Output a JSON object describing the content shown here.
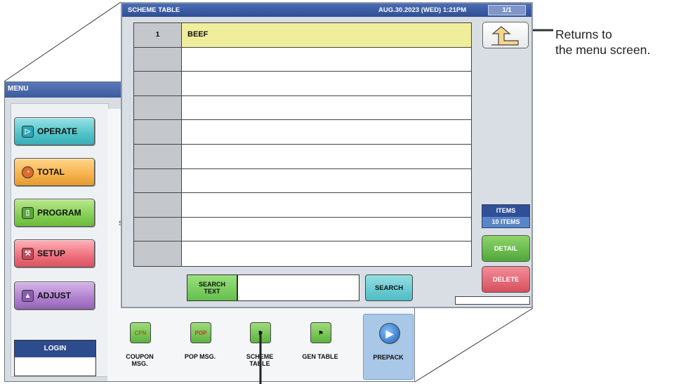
{
  "menu_window": {
    "title": "MENU",
    "stray_char": "S",
    "buttons": [
      {
        "label": "OPERATE",
        "icon": "play-circle-icon"
      },
      {
        "label": "TOTAL",
        "icon": "clock-icon"
      },
      {
        "label": "PROGRAM",
        "icon": "book-icon"
      },
      {
        "label": "SETUP",
        "icon": "wrench-icon"
      },
      {
        "label": "ADJUST",
        "icon": "adjust-icon"
      }
    ],
    "login_label": "LOGIN",
    "icon_row": [
      {
        "label": "COUPON\nMSG.",
        "icon_text": "CPN"
      },
      {
        "label": "POP MSG.",
        "icon_text": "POP"
      },
      {
        "label": "SCHEME\nTABLE",
        "icon_text": ""
      },
      {
        "label": "GEN TABLE",
        "icon_text": ""
      },
      {
        "label": "PREPACK",
        "icon_text": ""
      }
    ]
  },
  "scheme_window": {
    "title": "SCHEME TABLE",
    "datetime": "AUG.30.2023 (WED)  1:21PM",
    "page": "1/1",
    "rows": [
      {
        "num": "1",
        "name": "BEEF"
      },
      {
        "num": "",
        "name": ""
      },
      {
        "num": "",
        "name": ""
      },
      {
        "num": "",
        "name": ""
      },
      {
        "num": "",
        "name": ""
      },
      {
        "num": "",
        "name": ""
      },
      {
        "num": "",
        "name": ""
      },
      {
        "num": "",
        "name": ""
      },
      {
        "num": "",
        "name": ""
      },
      {
        "num": "",
        "name": ""
      }
    ],
    "items_label": "ITEMS",
    "items_value": "10 ITEMS",
    "detail_label": "DETAIL",
    "delete_label": "DELETE",
    "search_text_label": "SEARCH\nTEXT",
    "search_value": "",
    "search_button": "SEARCH"
  },
  "callout": {
    "line1": "Returns to",
    "line2": "the menu screen."
  },
  "colors": {
    "title_bar": "#3c5a9c",
    "selected_row": "#f0ee9c",
    "operate": "#4fc3c9",
    "total": "#f7b24a",
    "program": "#84cf52",
    "setup": "#ee6f7c",
    "adjust": "#b07fcf"
  }
}
